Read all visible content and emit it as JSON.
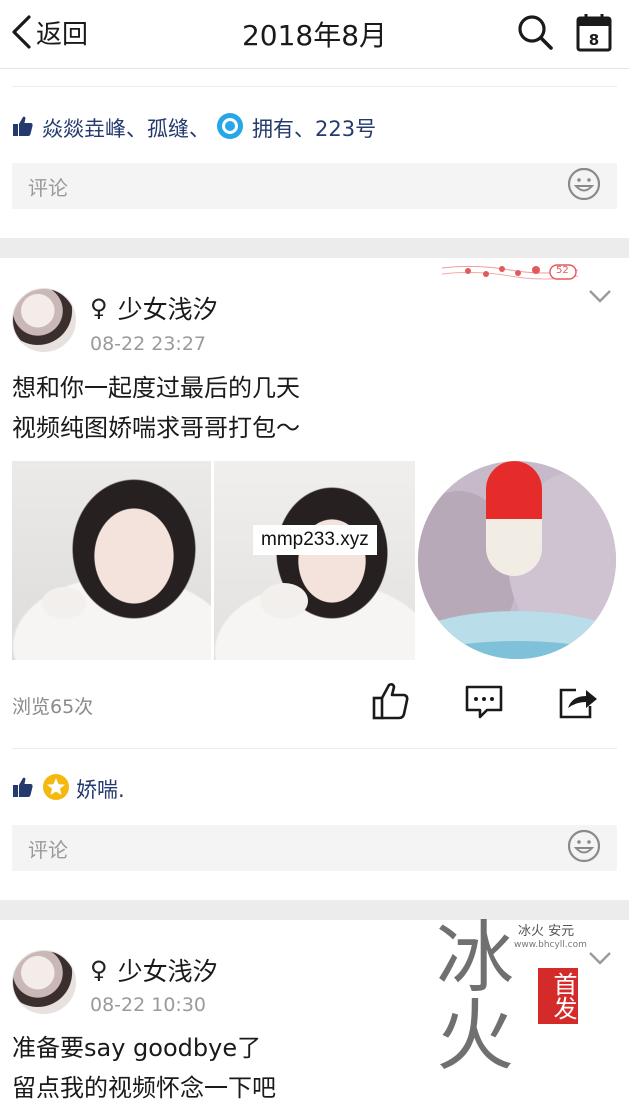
{
  "header": {
    "back_label": "返回",
    "title": "2018年8月"
  },
  "top_section": {
    "likes_prefix": "焱燚垚峰、孤缝、",
    "likes_suffix": "拥有、223号",
    "comment_placeholder": "评论"
  },
  "post1": {
    "author": "少女浅汐",
    "gender_symbol": "♀",
    "time": "08-22 23:27",
    "text_lines": [
      "想和你一起度过最后的几天",
      "视频纯图娇喘求哥哥打包～"
    ],
    "overlay_text": "mmp233.xyz",
    "views": "浏览65次",
    "likes": "娇喘.",
    "comment_placeholder": "评论",
    "deco_badge": "52"
  },
  "post2": {
    "author": "少女浅汐",
    "gender_symbol": "♀",
    "time": "08-22 10:30",
    "text_lines": [
      "准备要say goodbye了",
      "留点我的视频怀念一下吧"
    ]
  },
  "watermark": {
    "big_chars": "冰火",
    "red_chars": "首发",
    "small_text": "冰火 安元",
    "url": "www.bhcyll.com"
  },
  "colors": {
    "link_blue": "#243a6e",
    "muted_gray": "#9a9a9a",
    "divider": "#ececec",
    "badge_blue": "#27a7e7",
    "badge_gold": "#f5b80f",
    "brand_red": "#d42a2a"
  },
  "icons": [
    "chevron-left-icon",
    "search-icon",
    "calendar-icon",
    "thumbs-up-icon",
    "ring-badge-icon",
    "star-badge-icon",
    "smiley-icon",
    "chevron-down-icon",
    "like-outline-icon",
    "comment-icon",
    "share-icon"
  ]
}
